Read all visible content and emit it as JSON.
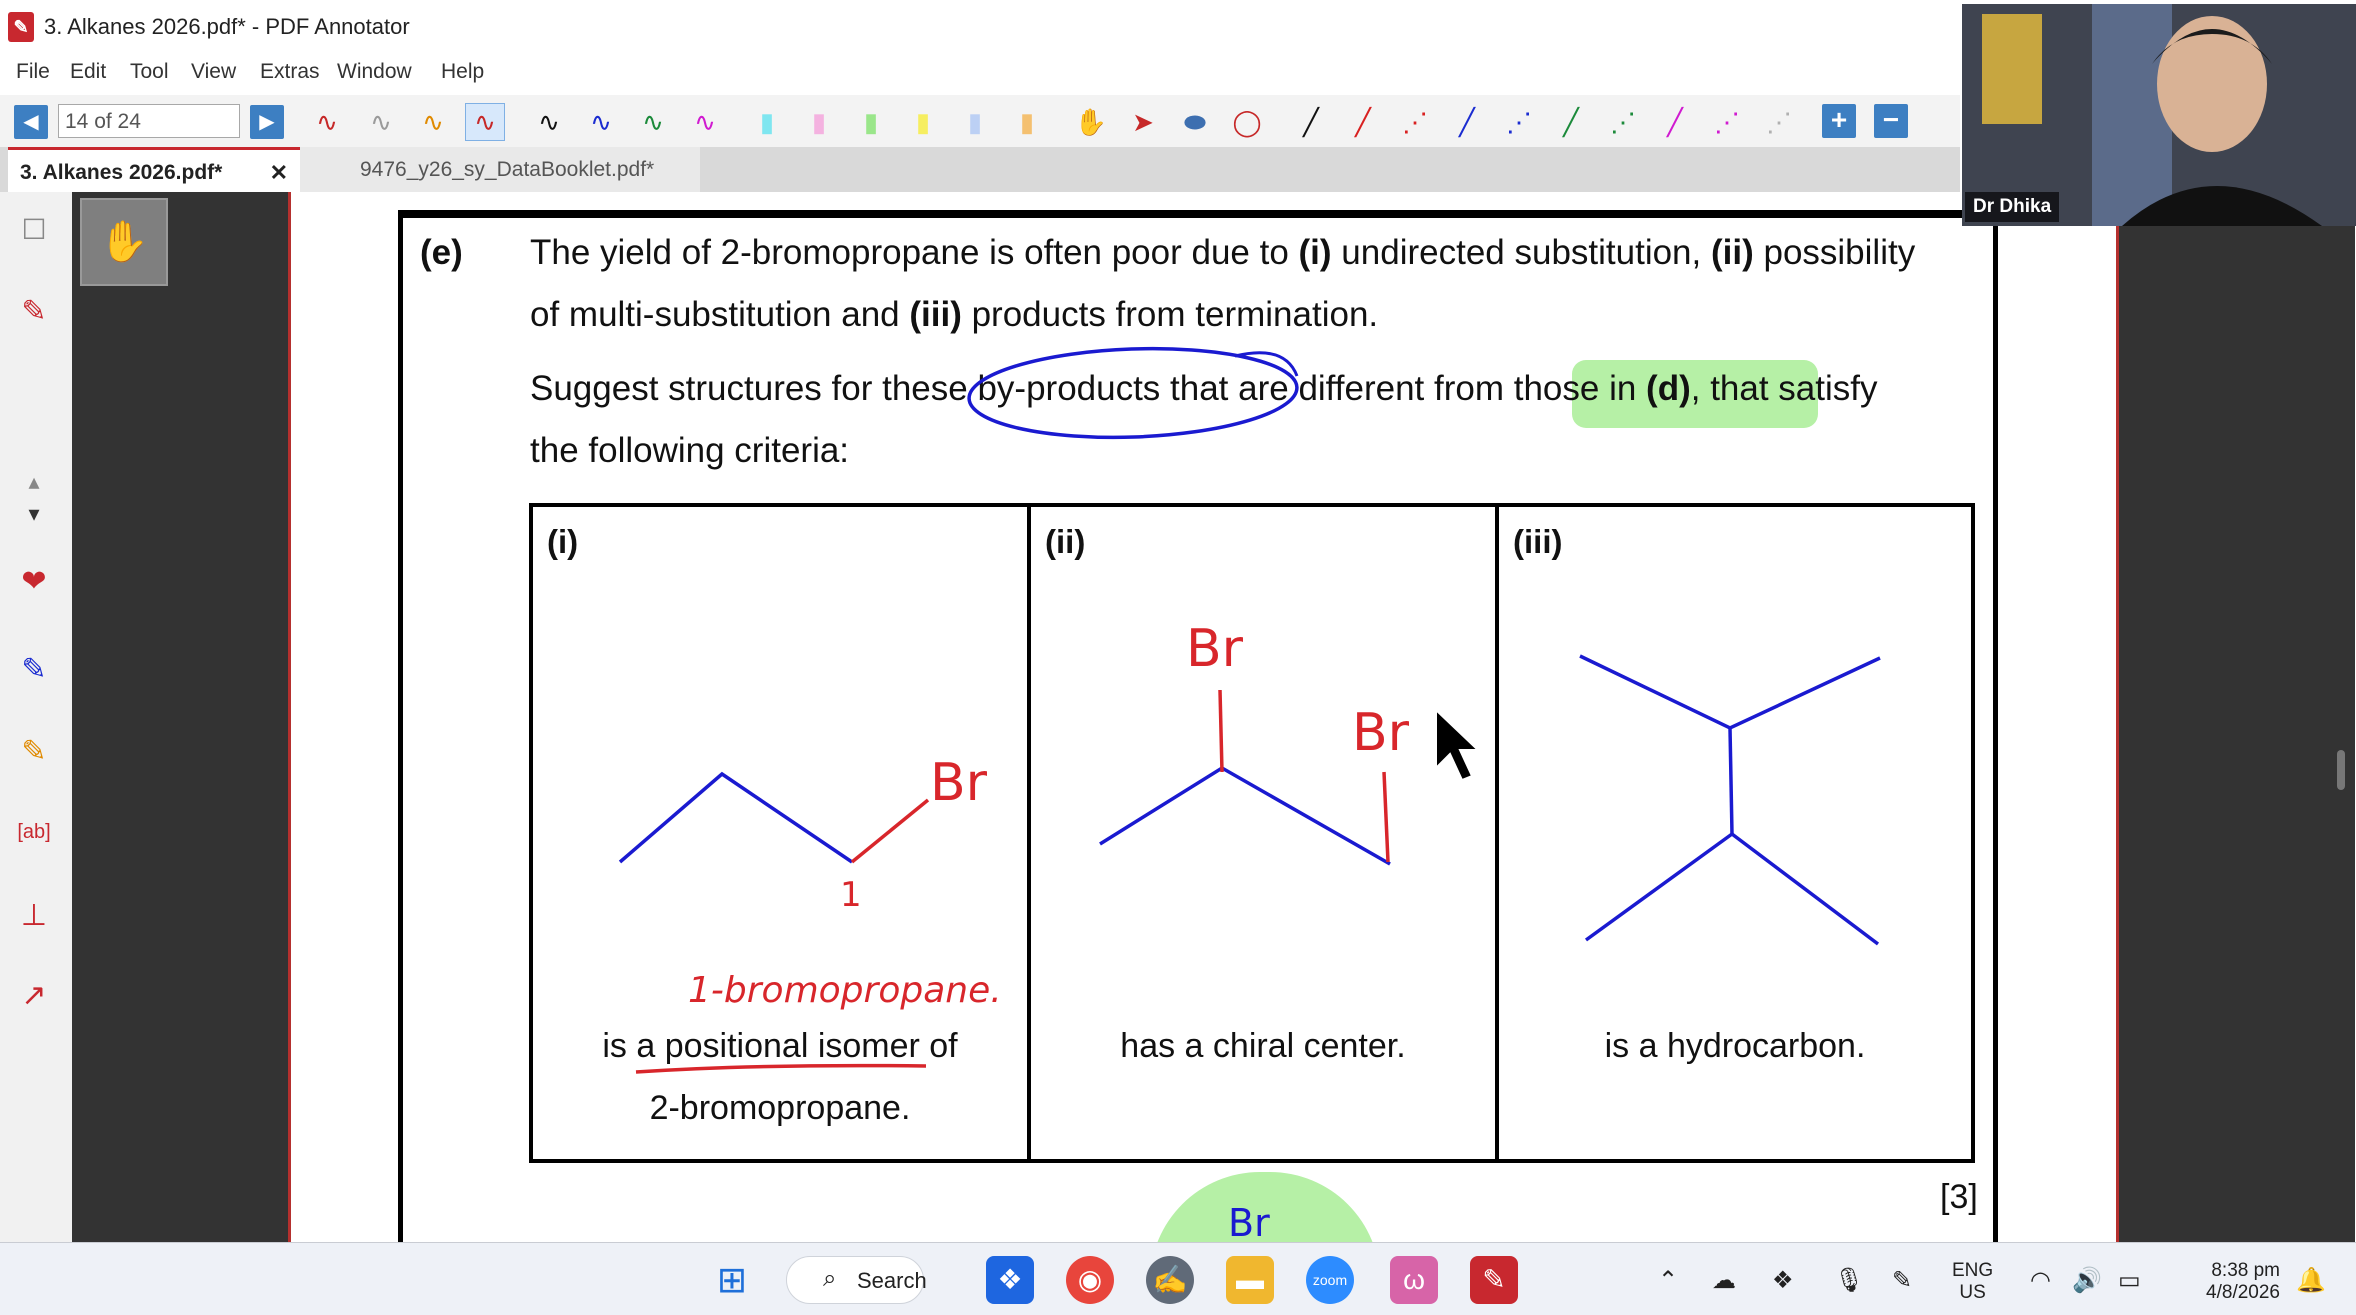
{
  "window": {
    "title": "3. Alkanes 2026.pdf* - PDF Annotator"
  },
  "menu": [
    "File",
    "Edit",
    "Tool",
    "View",
    "Extras",
    "Window",
    "Help"
  ],
  "toolbar": {
    "page_indicator": "14 of 24"
  },
  "tabs": [
    {
      "label": "3. Alkanes 2026.pdf*",
      "active": true
    },
    {
      "label": "9476_y26_sy_DataBooklet.pdf*",
      "active": false
    }
  ],
  "question": {
    "label": "(e)",
    "line1_a": "The yield of 2-bromopropane is often poor due to ",
    "line1_i": "(i)",
    "line1_b": " undirected substitution, ",
    "line1_ii": "(ii)",
    "line1_c": " possibility",
    "line2_a": "of multi-substitution and ",
    "line2_iii": "(iii)",
    "line2_b": " products from termination.",
    "line3_a": "Suggest structures for these by-products that are different from those in ",
    "line3_d": "(d)",
    "line3_b": ", that satisfy",
    "line4": "the following criteria:",
    "marks": "[3]"
  },
  "criteria": [
    {
      "label": "(i)",
      "text1": "is a positional isomer of",
      "text2": "2-bromopropane."
    },
    {
      "label": "(ii)",
      "text1": "has a chiral center."
    },
    {
      "label": "(iii)",
      "text1": "is a hydrocarbon."
    }
  ],
  "annotations": {
    "cell1_br": "Br",
    "cell1_number": "1",
    "cell1_name": "1-bromopropane.",
    "cell2_br_top": "Br",
    "cell2_br_right": "Br",
    "bottom_br": "Br"
  },
  "webcam": {
    "name": "Dr Dhika"
  },
  "taskbar": {
    "search_label": "Search",
    "lang_line1": "ENG",
    "lang_line2": "US",
    "time": "8:38 pm",
    "date": "4/8/2026"
  },
  "colors": {
    "ink_red": "#d8262b",
    "ink_blue": "#1a1ad0",
    "highlight_green": "#b6f0a6",
    "accent_blue": "#3d7fc2",
    "app_red": "#c8282f"
  }
}
